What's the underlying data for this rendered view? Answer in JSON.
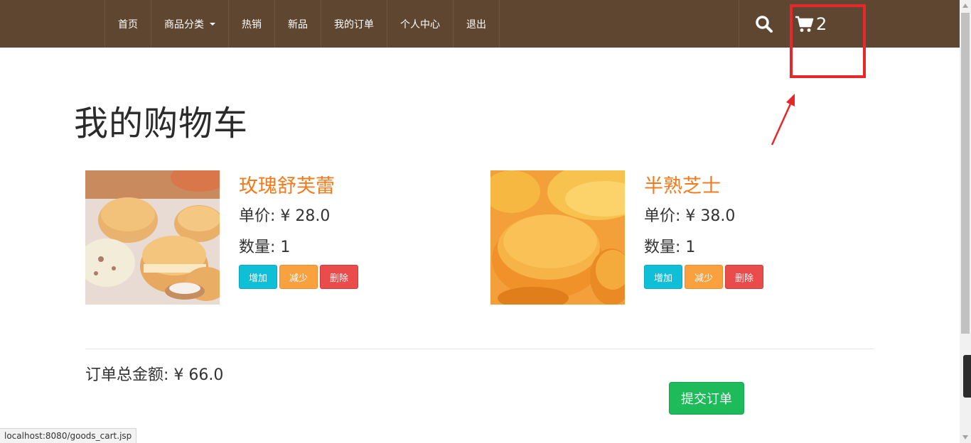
{
  "nav": {
    "items": [
      {
        "label": "首页"
      },
      {
        "label": "商品分类"
      },
      {
        "label": "热销"
      },
      {
        "label": "新品"
      },
      {
        "label": "我的订单"
      },
      {
        "label": "个人中心"
      },
      {
        "label": "退出"
      }
    ],
    "cart_count": "2",
    "bg_color": "#5e4630"
  },
  "page": {
    "title": "我的购物车"
  },
  "cart": {
    "items": [
      {
        "name": "玫瑰舒芙蕾",
        "price": "单价: ¥ 28.0",
        "quantity": "数量: 1"
      },
      {
        "name": "半熟芝士",
        "price": "单价: ¥ 38.0",
        "quantity": "数量: 1"
      }
    ],
    "buttons": {
      "add": "增加",
      "minus": "减少",
      "delete": "删除"
    },
    "total": "订单总金额: ¥ 66.0",
    "submit_label": "提交订单"
  },
  "status_bar": {
    "url": "localhost:8080/goods_cart.jsp"
  },
  "colors": {
    "accent_orange": "#f37b1d",
    "btn_add": "#0fbfd8",
    "btn_minus": "#f9a03f",
    "btn_delete": "#ea4b4b",
    "btn_submit": "#1dbb5a",
    "annotation_red": "#e8272c"
  },
  "icons": {
    "search": "search-icon",
    "cart": "shopping-cart-icon"
  }
}
